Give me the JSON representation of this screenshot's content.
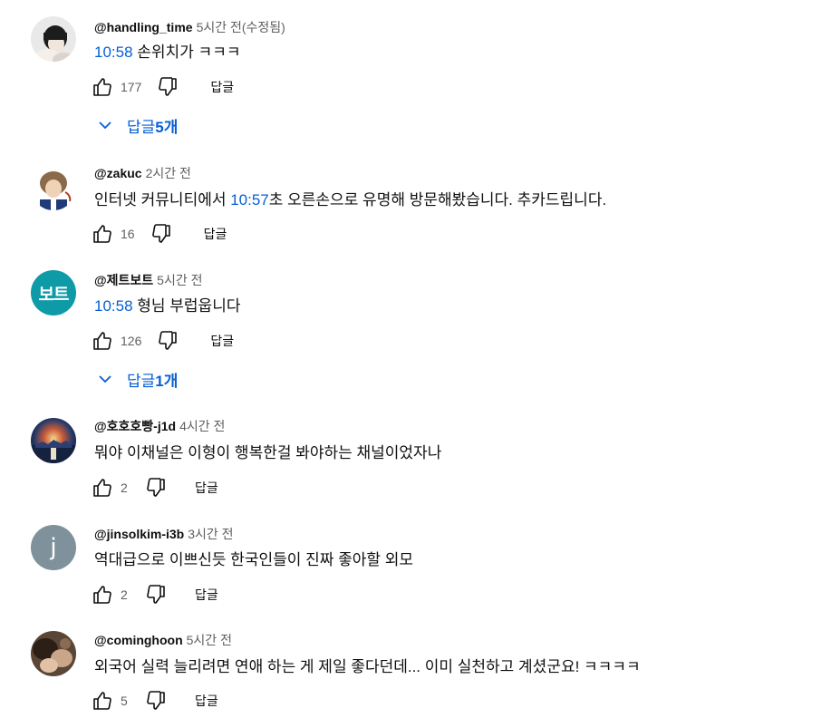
{
  "ui": {
    "reply_label": "답글"
  },
  "colors": {
    "accent": "#065fd4",
    "secondary_text": "#606060"
  },
  "comments": [
    {
      "author": "@handling_time",
      "time": "5시간 전(수정됨)",
      "timestamp": "10:58",
      "text_before": "",
      "text_after": " 손위치가 ㅋㅋㅋ",
      "likes": "177",
      "avatar_icon": "avatar-photo-icon",
      "replies": {
        "prefix": "답글 ",
        "count": "5개"
      }
    },
    {
      "author": "@zakuc",
      "time": "2시간 전",
      "timestamp": "10:57",
      "text_before": "인터넷 커뮤니티에서 ",
      "text_after": "초 오른손으로 유명해 방문해봤습니다. 추카드립니다.",
      "likes": "16",
      "avatar_icon": "avatar-photo-icon"
    },
    {
      "author": "@제트보트",
      "time": "5시간 전",
      "timestamp": "10:58",
      "text_before": "",
      "text_after": " 형님 부럽웁니다",
      "likes": "126",
      "avatar_text": "보트",
      "avatar_color": "#0f9aa8",
      "replies": {
        "prefix": "답글 ",
        "count": "1개"
      }
    },
    {
      "author": "@호호호빵-j1d",
      "time": "4시간 전",
      "text": "뭐야 이채널은 이형이 행복한걸 봐야하는 채널이었자나",
      "likes": "2",
      "avatar_icon": "avatar-photo-icon"
    },
    {
      "author": "@jinsolkim-i3b",
      "time": "3시간 전",
      "text": "역대급으로 이쁘신듯 한국인들이 진짜 좋아할 외모",
      "likes": "2",
      "avatar_text": "j",
      "avatar_color": "#7f919b"
    },
    {
      "author": "@cominghoon",
      "time": "5시간 전",
      "text": "외국어 실력 늘리려면 연애 하는 게 제일 좋다던데... 이미 실천하고 계셨군요! ㅋㅋㅋㅋ",
      "likes": "5",
      "avatar_icon": "avatar-photo-icon"
    }
  ]
}
